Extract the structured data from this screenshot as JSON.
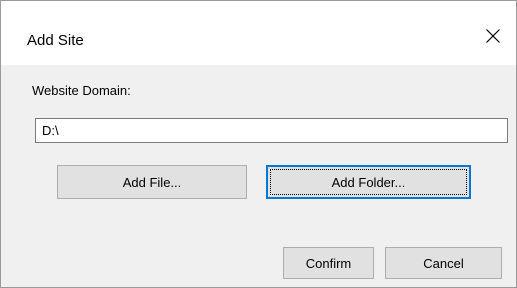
{
  "dialog": {
    "title": "Add Site",
    "close_icon": "close-icon",
    "domain_label": "Website Domain:",
    "domain_value": "D:\\",
    "buttons": {
      "add_file": "Add File...",
      "add_folder": "Add Folder...",
      "confirm": "Confirm",
      "cancel": "Cancel"
    },
    "colors": {
      "focus_accent": "#0078d7",
      "dialog_background": "#f0f0f0",
      "button_background": "#e1e1e1"
    }
  }
}
